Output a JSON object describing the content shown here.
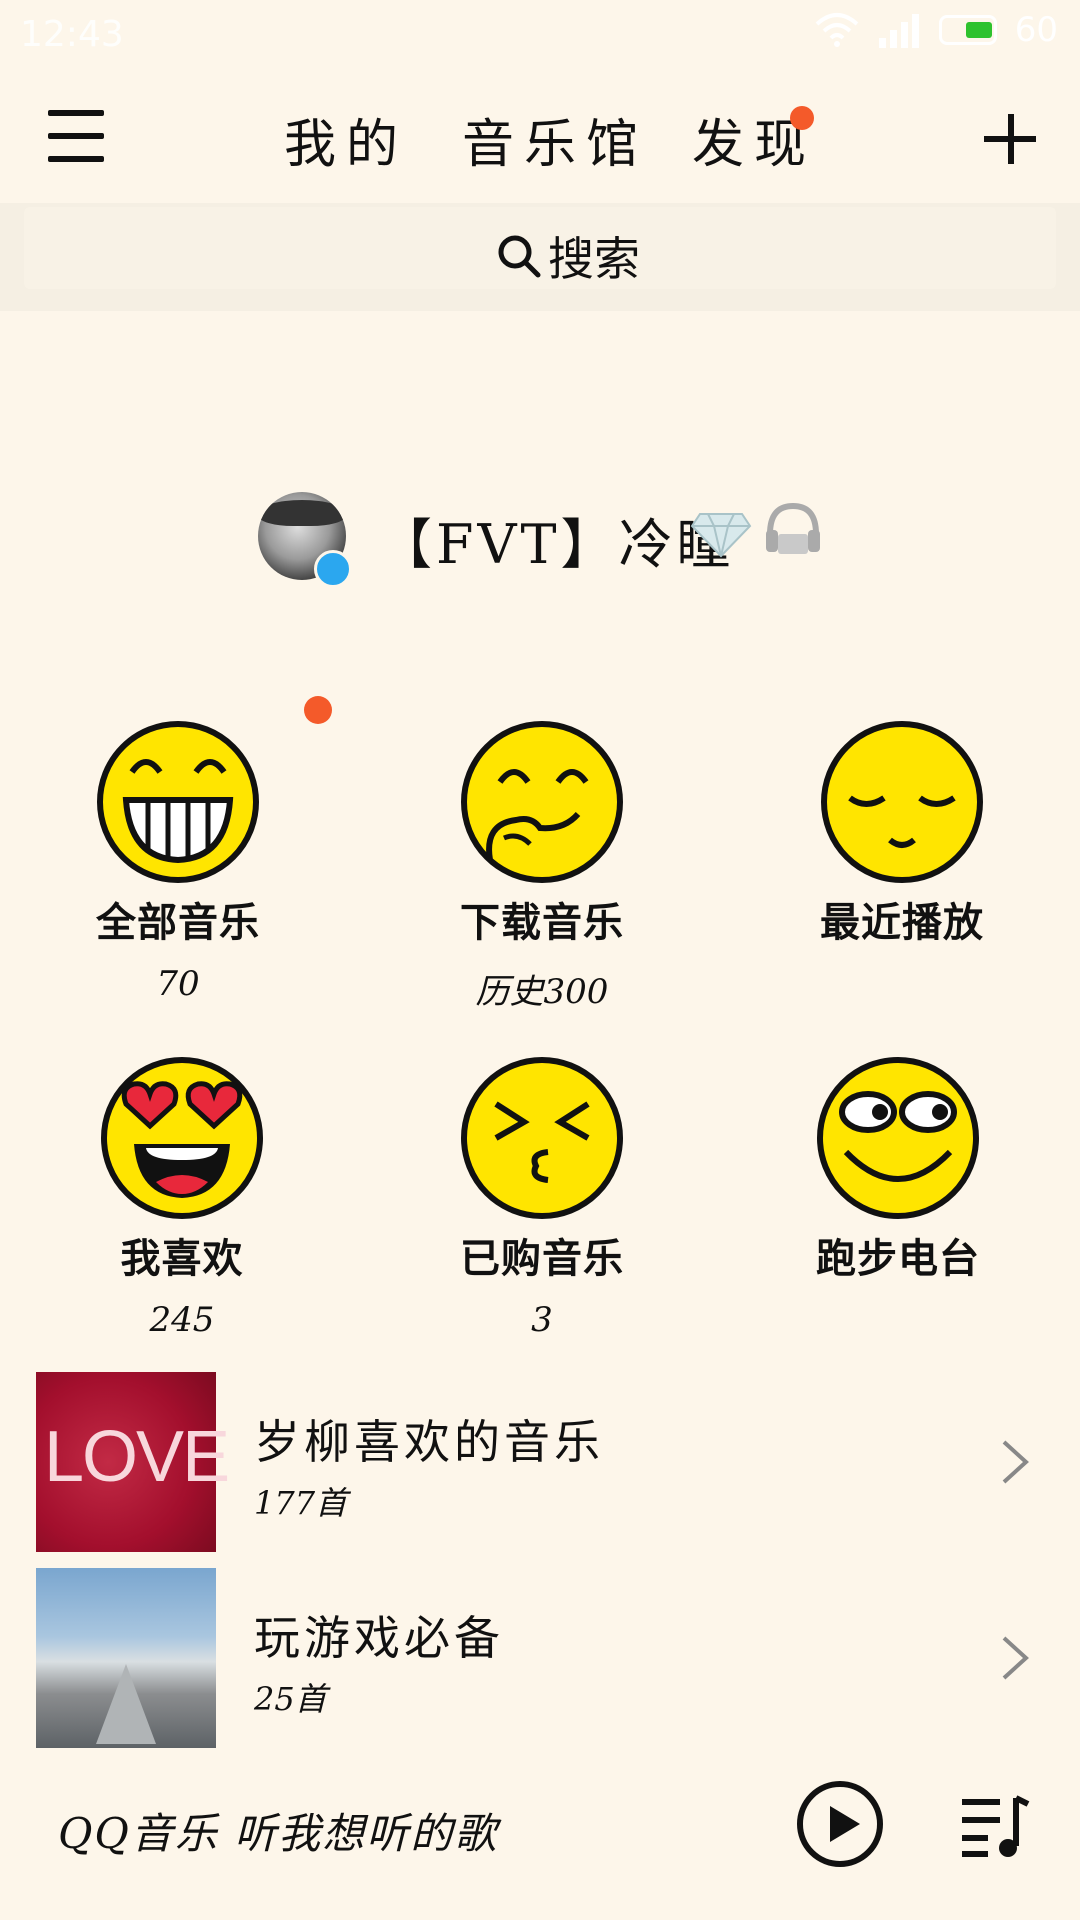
{
  "status_bar": {
    "time": "12:43",
    "battery": "60"
  },
  "nav": {
    "tabs": [
      {
        "label": "我的"
      },
      {
        "label": "音乐馆"
      },
      {
        "label": "发现"
      }
    ]
  },
  "search": {
    "placeholder": "搜索"
  },
  "profile": {
    "username": "【FVT】冷瞳"
  },
  "grid": [
    {
      "label": "全部音乐",
      "count": "70"
    },
    {
      "label": "下载音乐",
      "count": "历史300"
    },
    {
      "label": "最近播放",
      "count": ""
    },
    {
      "label": "我喜欢",
      "count": "245"
    },
    {
      "label": "已购音乐",
      "count": "3"
    },
    {
      "label": "跑步电台",
      "count": ""
    }
  ],
  "playlists": [
    {
      "title": "岁柳喜欢的音乐",
      "count": "177首",
      "cover_text": "LOVE"
    },
    {
      "title": "玩游戏必备",
      "count": "25首"
    }
  ],
  "player": {
    "slogan": "QQ音乐 听我想听的歌"
  },
  "colors": {
    "background": "#fdf6ea",
    "accent_dot": "#f45a2a",
    "face": "#ffe500"
  }
}
